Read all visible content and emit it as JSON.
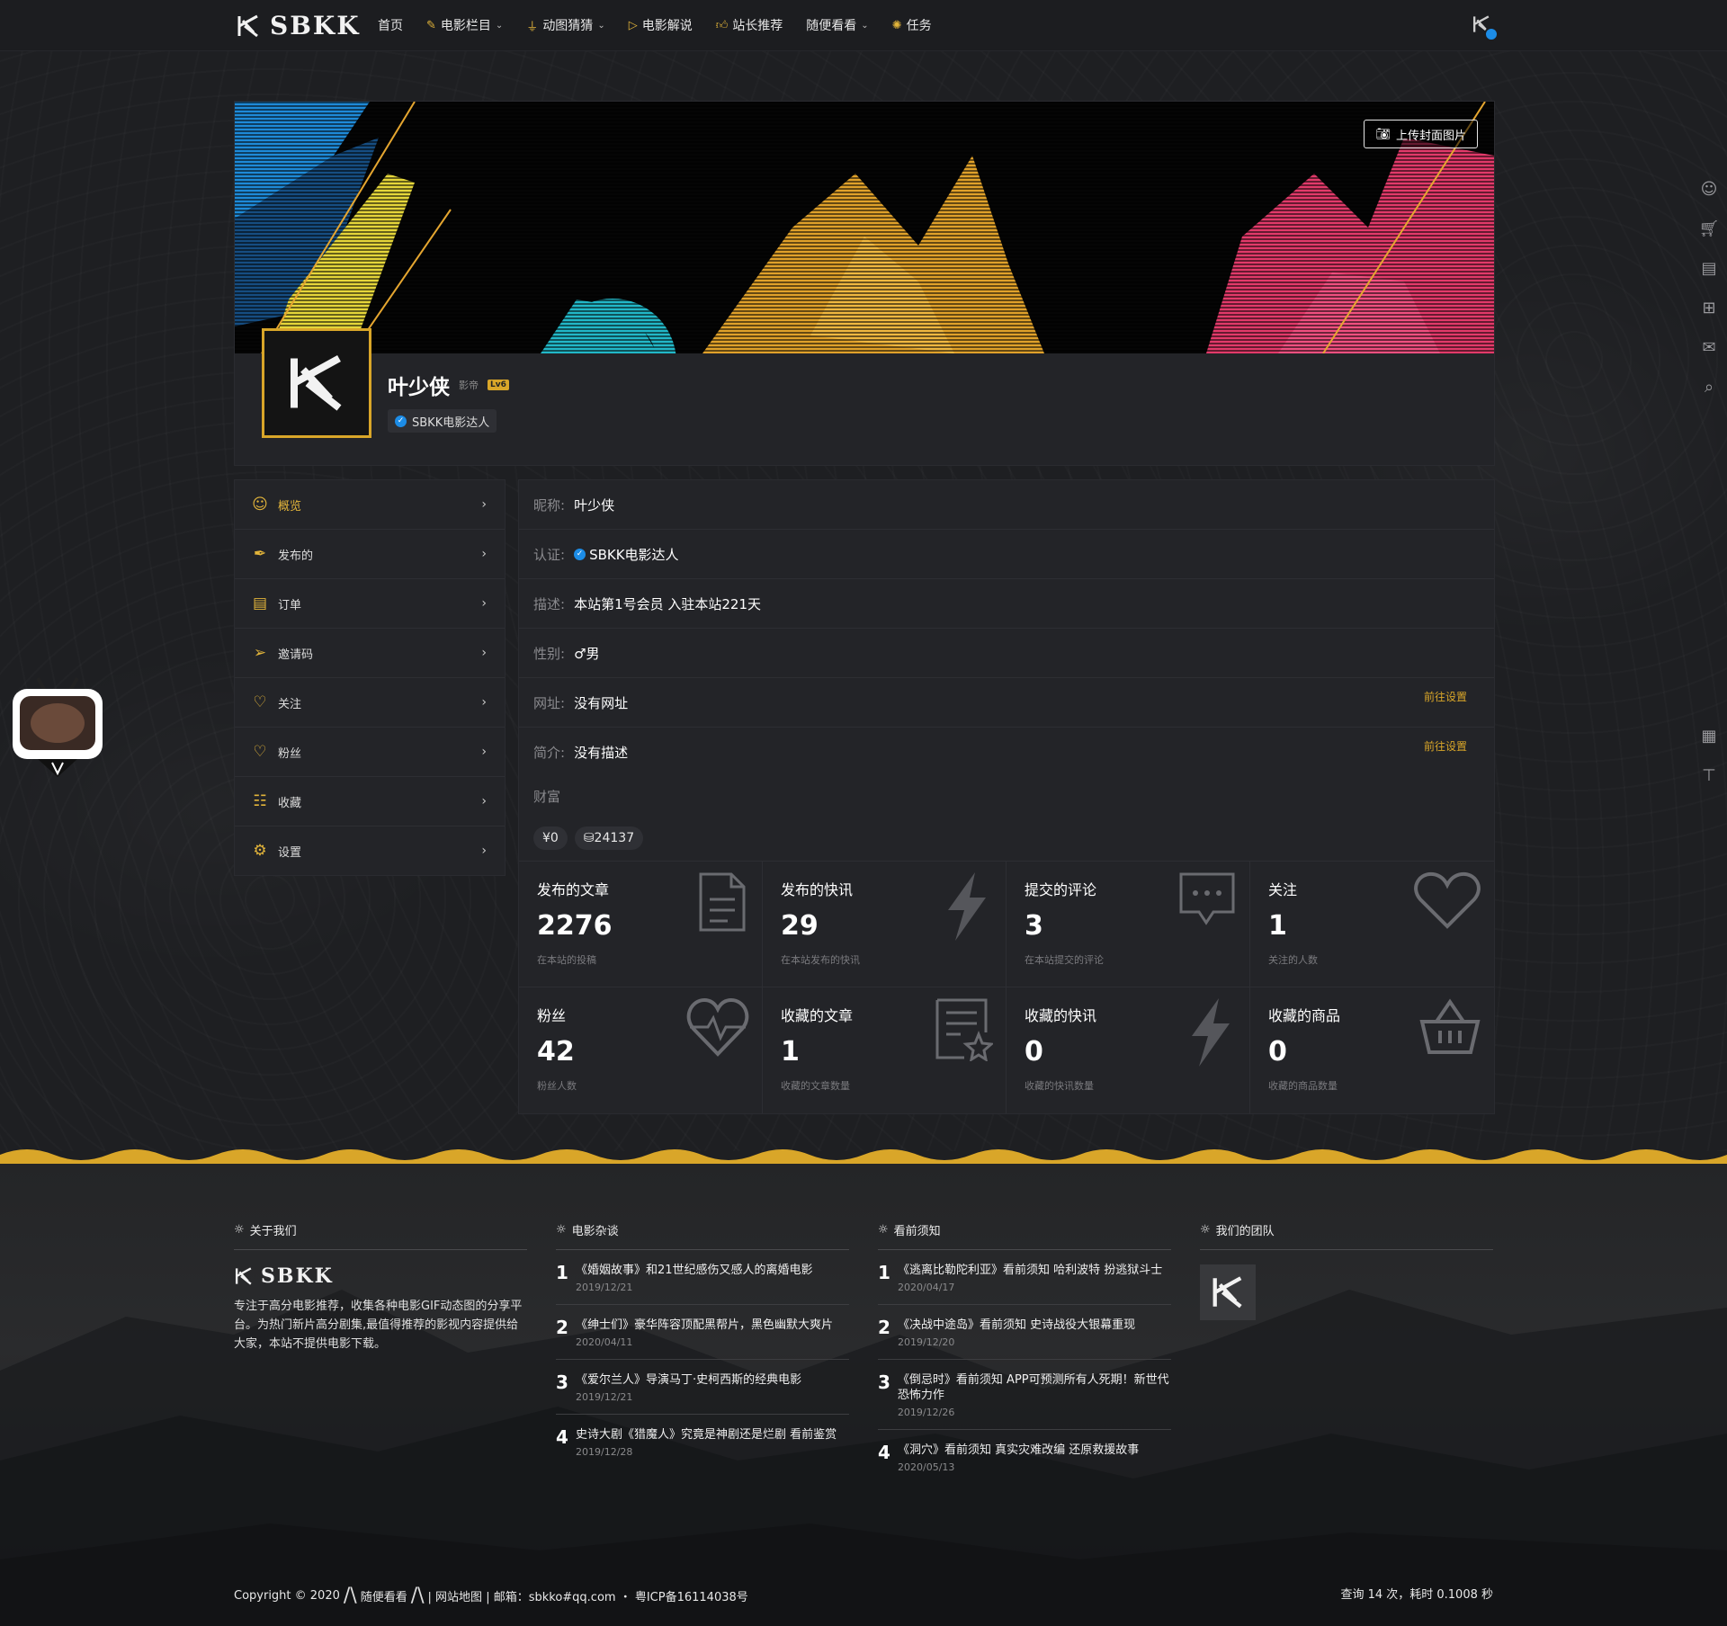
{
  "site": {
    "name": "SBKK",
    "accent": "#d9a629"
  },
  "nav": [
    {
      "label": "首页",
      "icon": ""
    },
    {
      "label": "电影栏目",
      "icon": "pen-icon",
      "dropdown": true
    },
    {
      "label": "动图猜猜",
      "icon": "thumb-icon",
      "dropdown": true
    },
    {
      "label": "电影解说",
      "icon": "play-icon"
    },
    {
      "label": "站长推荐",
      "icon": "like-icon"
    },
    {
      "label": "随便看看",
      "icon": "",
      "dropdown": true
    },
    {
      "label": "任务",
      "icon": "bulb-icon"
    }
  ],
  "cover": {
    "upload_label": "上传封面图片"
  },
  "profile": {
    "name": "叶少侠",
    "level_text": "影帝",
    "level_badge": "Lv6",
    "verify": "SBKK电影达人"
  },
  "sidebar": [
    {
      "label": "概览",
      "icon": "user-icon",
      "active": true
    },
    {
      "label": "发布的",
      "icon": "feather-icon"
    },
    {
      "label": "订单",
      "icon": "order-icon"
    },
    {
      "label": "邀请码",
      "icon": "paper-plane-icon"
    },
    {
      "label": "关注",
      "icon": "heart-icon"
    },
    {
      "label": "粉丝",
      "icon": "heart-pulse-icon"
    },
    {
      "label": "收藏",
      "icon": "collect-icon"
    },
    {
      "label": "设置",
      "icon": "gear-icon"
    }
  ],
  "info": {
    "nickname_label": "昵称:",
    "nickname": "叶少侠",
    "verify_label": "认证:",
    "verify": "SBKK电影达人",
    "desc_label": "描述:",
    "desc": "本站第1号会员 入驻本站221天",
    "gender_label": "性别:",
    "gender": "♂男",
    "site_label": "网址:",
    "site": "没有网址",
    "site_action": "前往设置",
    "bio_label": "简介:",
    "bio": "没有描述",
    "bio_action": "前往设置",
    "wealth_label": "财富",
    "money": "¥0",
    "points": "⛁24137"
  },
  "stats": [
    {
      "title": "发布的文章",
      "value": "2276",
      "sub": "在本站的投稿",
      "icon": "document-icon"
    },
    {
      "title": "发布的快讯",
      "value": "29",
      "sub": "在本站发布的快讯",
      "icon": "lightning-icon"
    },
    {
      "title": "提交的评论",
      "value": "3",
      "sub": "在本站提交的评论",
      "icon": "comment-icon"
    },
    {
      "title": "关注",
      "value": "1",
      "sub": "关注的人数",
      "icon": "heart-icon"
    },
    {
      "title": "粉丝",
      "value": "42",
      "sub": "粉丝人数",
      "icon": "heart-pulse-icon"
    },
    {
      "title": "收藏的文章",
      "value": "1",
      "sub": "收藏的文章数量",
      "icon": "doc-star-icon"
    },
    {
      "title": "收藏的快讯",
      "value": "0",
      "sub": "收藏的快讯数量",
      "icon": "lightning-icon"
    },
    {
      "title": "收藏的商品",
      "value": "0",
      "sub": "收藏的商品数量",
      "icon": "basket-icon"
    }
  ],
  "footer": {
    "about_title": "关于我们",
    "about_text": "专注于高分电影推荐，收集各种电影GIF动态图的分享平台。为热门新片高分剧集,最值得推荐的影视内容提供给大家，本站不提供电影下载。",
    "col2_title": "电影杂谈",
    "col2_posts": [
      {
        "num": "1",
        "title": "《婚姻故事》和21世纪感伤又感人的离婚电影",
        "date": "2019/12/21"
      },
      {
        "num": "2",
        "title": "《绅士们》豪华阵容顶配黑帮片，黑色幽默大爽片",
        "date": "2020/04/11"
      },
      {
        "num": "3",
        "title": "《爱尔兰人》导演马丁·史柯西斯的经典电影",
        "date": "2019/12/21"
      },
      {
        "num": "4",
        "title": "史诗大剧《猎魔人》究竟是神剧还是烂剧 看前鉴赏",
        "date": "2019/12/28"
      }
    ],
    "col3_title": "看前须知",
    "col3_posts": [
      {
        "num": "1",
        "title": "《逃离比勒陀利亚》看前须知 哈利波特 扮逃狱斗士",
        "date": "2020/04/17"
      },
      {
        "num": "2",
        "title": "《决战中途岛》看前须知 史诗战役大银幕重现",
        "date": "2019/12/20"
      },
      {
        "num": "3",
        "title": "《倒忌时》看前须知 APP可预测所有人死期！新世代恐怖力作",
        "date": "2019/12/26"
      },
      {
        "num": "4",
        "title": "《洞穴》看前须知 真实灾难改编 还原救援故事",
        "date": "2020/05/13"
      }
    ],
    "col4_title": "我们的团队",
    "copyright_prefix": "Copyright © 2020",
    "copyright_link": "随便看看",
    "copyright_rest": "| 网站地图 | 邮箱：sbkko#qq.com ・ 粤ICP备16114038号",
    "query": "查询 14 次，耗时 0.1008 秒"
  }
}
